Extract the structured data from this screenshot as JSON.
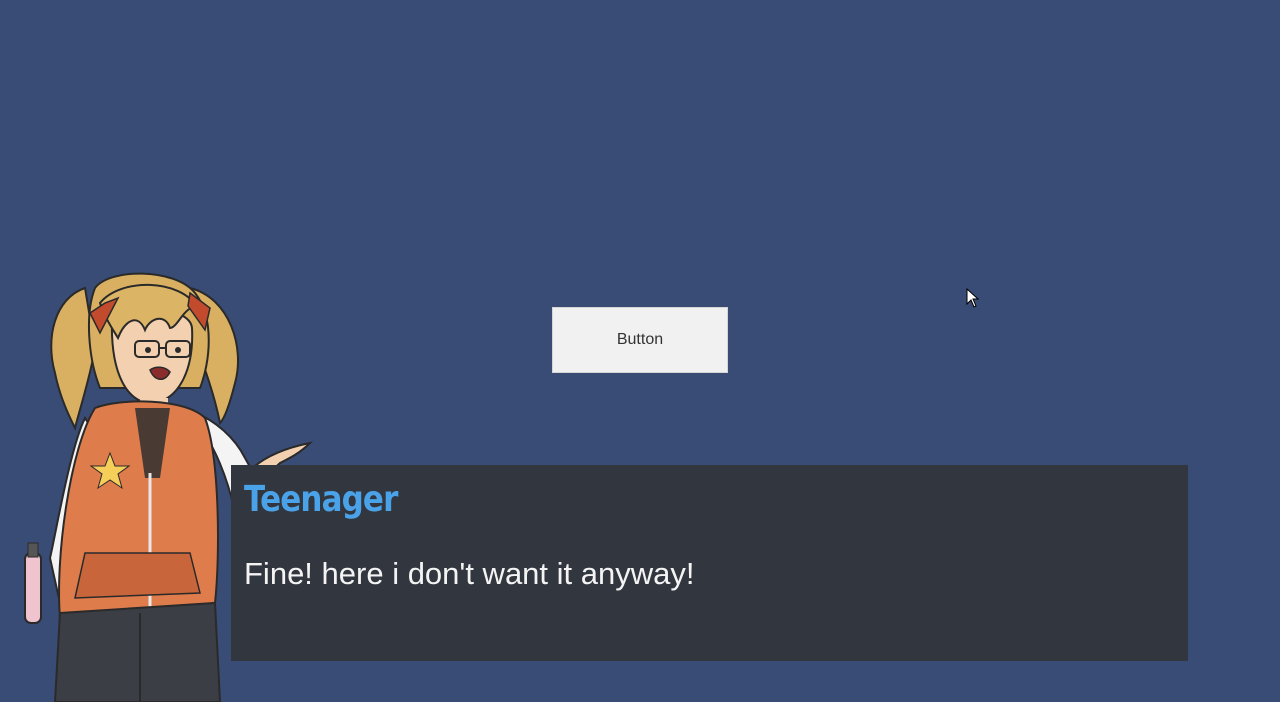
{
  "button": {
    "label": "Button"
  },
  "dialog": {
    "speaker": "Teenager",
    "line": "Fine! here i don't want it anyway!"
  },
  "colors": {
    "background": "#394c75",
    "dialog_box": "#32363f",
    "speaker_name": "#4aa3e8",
    "dialog_text": "#f4f4f4",
    "button_bg": "#f1f1f1"
  },
  "icons": {
    "character": "teenager-girl-portrait",
    "cursor": "mouse-pointer-icon"
  }
}
